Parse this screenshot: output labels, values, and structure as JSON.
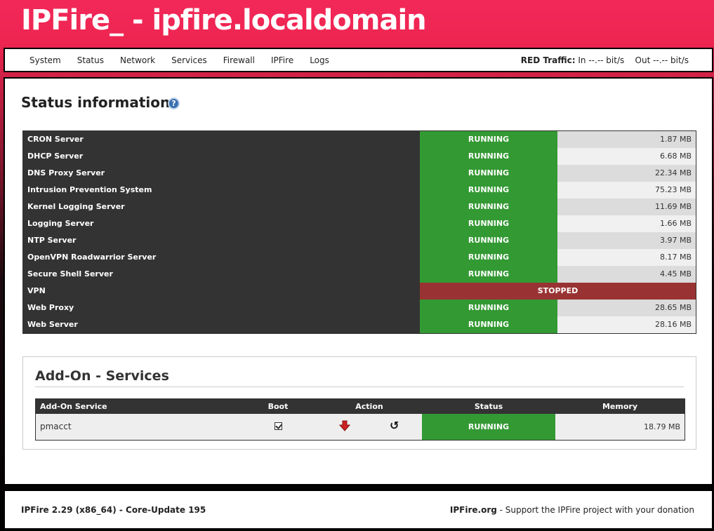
{
  "header": {
    "title": "IPFire_ - ipfire.localdomain"
  },
  "nav": {
    "items": [
      {
        "label": "System"
      },
      {
        "label": "Status"
      },
      {
        "label": "Network"
      },
      {
        "label": "Services"
      },
      {
        "label": "Firewall"
      },
      {
        "label": "IPFire"
      },
      {
        "label": "Logs"
      }
    ],
    "traffic_label": "RED Traffic:",
    "traffic_in": "In --.-- bit/s",
    "traffic_out": "Out --.-- bit/s"
  },
  "main": {
    "title": "Status information",
    "help_icon": "?",
    "services": [
      {
        "name": "CRON Server",
        "status": "RUNNING",
        "memory": "1.87 MB"
      },
      {
        "name": "DHCP Server",
        "status": "RUNNING",
        "memory": "6.68 MB"
      },
      {
        "name": "DNS Proxy Server",
        "status": "RUNNING",
        "memory": "22.34 MB"
      },
      {
        "name": "Intrusion Prevention System",
        "status": "RUNNING",
        "memory": "75.23 MB"
      },
      {
        "name": "Kernel Logging Server",
        "status": "RUNNING",
        "memory": "11.69 MB"
      },
      {
        "name": "Logging Server",
        "status": "RUNNING",
        "memory": "1.66 MB"
      },
      {
        "name": "NTP Server",
        "status": "RUNNING",
        "memory": "3.97 MB"
      },
      {
        "name": "OpenVPN Roadwarrior Server",
        "status": "RUNNING",
        "memory": "8.17 MB"
      },
      {
        "name": "Secure Shell Server",
        "status": "RUNNING",
        "memory": "4.45 MB"
      },
      {
        "name": "VPN",
        "status": "STOPPED",
        "memory": ""
      },
      {
        "name": "Web Proxy",
        "status": "RUNNING",
        "memory": "28.65 MB"
      },
      {
        "name": "Web Server",
        "status": "RUNNING",
        "memory": "28.16 MB"
      }
    ],
    "colors": {
      "running": "#339933",
      "stopped": "#993333"
    }
  },
  "addons": {
    "title": "Add-On - Services",
    "headers": {
      "service": "Add-On Service",
      "boot": "Boot",
      "action": "Action",
      "status": "Status",
      "memory": "Memory"
    },
    "rows": [
      {
        "service": "pmacct",
        "status": "RUNNING",
        "memory": "18.79 MB"
      }
    ]
  },
  "footer": {
    "version": "IPFire 2.29 (x86_64) - Core-Update 195",
    "site": "IPFire.org",
    "support": " - Support the IPFire project with your donation"
  }
}
